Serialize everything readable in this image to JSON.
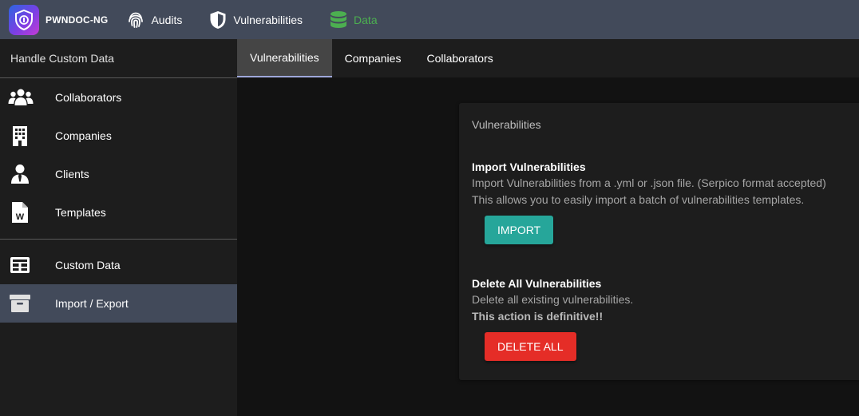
{
  "app": {
    "name": "PWNDOC-NG"
  },
  "topnav": {
    "audits": "Audits",
    "vulnerabilities": "Vulnerabilities",
    "data": "Data",
    "data_color": "#4caf50"
  },
  "sidebar": {
    "header": "Handle Custom Data",
    "items": [
      {
        "label": "Collaborators",
        "icon": "users-icon"
      },
      {
        "label": "Companies",
        "icon": "building-icon"
      },
      {
        "label": "Clients",
        "icon": "user-tie-icon"
      },
      {
        "label": "Templates",
        "icon": "word-file-icon"
      },
      {
        "label": "Custom Data",
        "icon": "table-icon"
      },
      {
        "label": "Import / Export",
        "icon": "archive-icon"
      }
    ]
  },
  "tabs": [
    "Vulnerabilities",
    "Companies",
    "Collaborators"
  ],
  "card": {
    "title": "Vulnerabilities",
    "import": {
      "title": "Import Vulnerabilities",
      "line1": "Import Vulnerabilities from a .yml or .json file. (Serpico format accepted)",
      "line2": "This allows you to easily import a batch of vulnerabilities templates.",
      "button": "IMPORT"
    },
    "delete": {
      "title": "Delete All Vulnerabilities",
      "line1": "Delete all existing vulnerabilities.",
      "warning": "This action is definitive!!",
      "button": "DELETE ALL"
    }
  },
  "colors": {
    "accent_import": "#26a69a",
    "accent_delete": "#e52d27",
    "topbar": "#424a5a"
  }
}
